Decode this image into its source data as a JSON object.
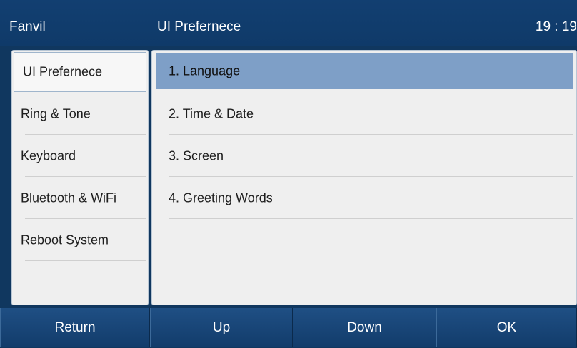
{
  "header": {
    "brand": "Fanvil",
    "title": "UI Prefernece",
    "clock": "19 : 19"
  },
  "sidebar": {
    "selected_index": 0,
    "items": [
      {
        "label": "UI Prefernece"
      },
      {
        "label": "Ring & Tone"
      },
      {
        "label": "Keyboard"
      },
      {
        "label": "Bluetooth & WiFi"
      },
      {
        "label": "Reboot System"
      }
    ]
  },
  "menu": {
    "selected_index": 0,
    "items": [
      {
        "label": "1.  Language"
      },
      {
        "label": "2.  Time & Date"
      },
      {
        "label": "3.  Screen"
      },
      {
        "label": "4.  Greeting Words"
      }
    ]
  },
  "softkeys": [
    {
      "label": "Return"
    },
    {
      "label": "Up"
    },
    {
      "label": "Down"
    },
    {
      "label": "OK"
    }
  ],
  "colors": {
    "header_bg": "#123f71",
    "body_bg": "#10375f",
    "panel_bg": "#efefef",
    "selection": "#7e9fc7"
  }
}
